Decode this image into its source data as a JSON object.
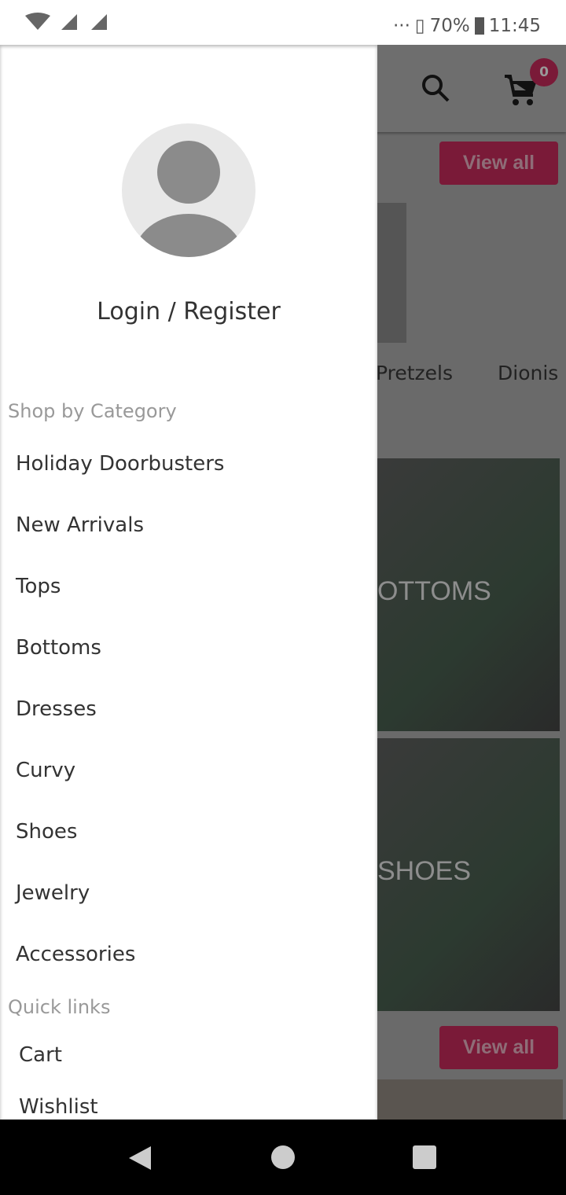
{
  "status_bar": {
    "battery": "70%",
    "time": "11:45",
    "dots": "···"
  },
  "background": {
    "cart_count": "0",
    "view_all_label": "View all",
    "brands": [
      "Pretzels",
      "Dionis I"
    ],
    "banners": [
      "OTTOMS",
      "SHOES"
    ]
  },
  "drawer": {
    "login_label": "Login / Register",
    "shop_by_category_title": "Shop by Category",
    "categories": [
      "Holiday Doorbusters",
      "New Arrivals",
      "Tops",
      "Bottoms",
      "Dresses",
      "Curvy",
      "Shoes",
      "Jewelry",
      "Accessories"
    ],
    "quick_links_title": "Quick links",
    "quick_links": [
      "Cart",
      "Wishlist"
    ]
  },
  "colors": {
    "accent": "#c2185b"
  }
}
